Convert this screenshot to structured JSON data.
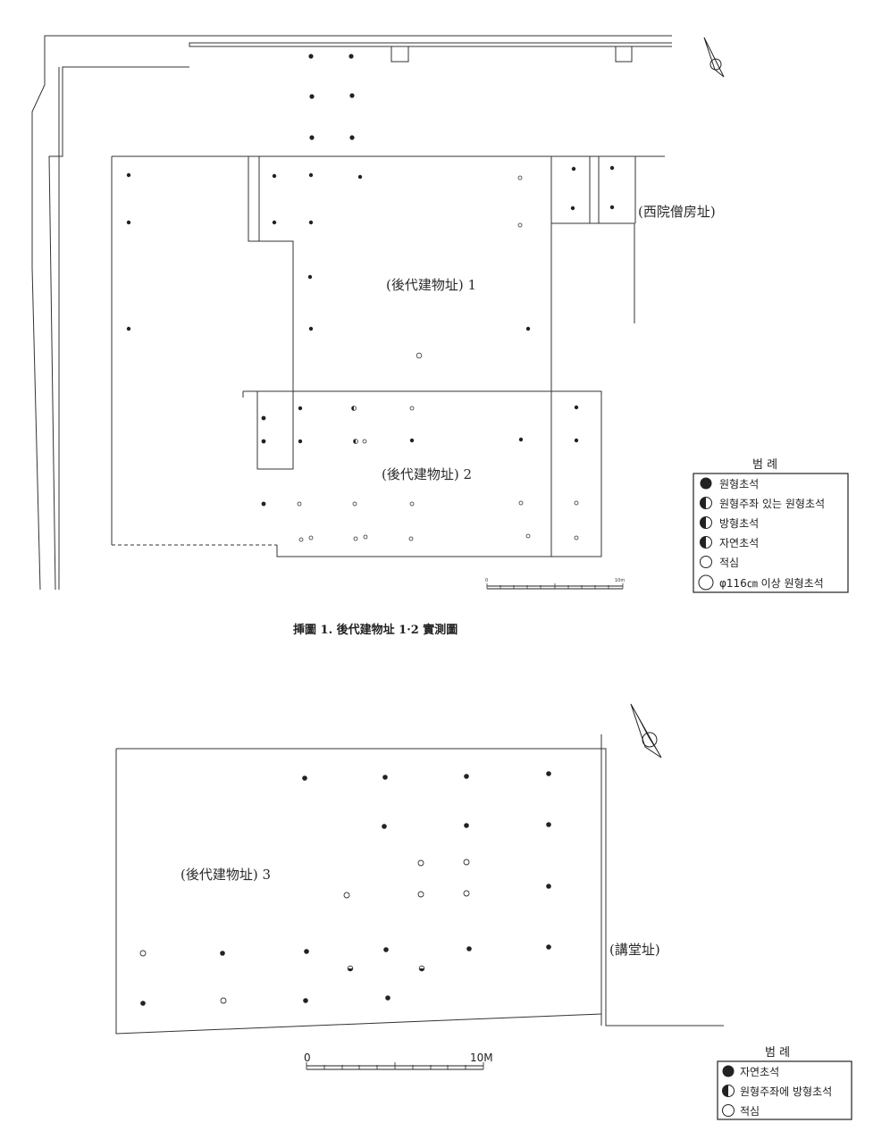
{
  "top_plan": {
    "labels": {
      "west_monk_quarters": "(西院僧房址)",
      "building1": "(後代建物址) 1",
      "building2": "(後代建物址) 2"
    },
    "scale": {
      "zero": "0",
      "end": "10m"
    },
    "caption": "挿圖 1. 後代建物址 1·2 實測圖",
    "legend": {
      "title": "범 례",
      "items": [
        {
          "symbol": "filled",
          "label": "원형초석"
        },
        {
          "symbol": "half",
          "label": "원형주좌 있는 원형초석"
        },
        {
          "symbol": "half",
          "label": "방형초석"
        },
        {
          "symbol": "half",
          "label": "자연초석"
        },
        {
          "symbol": "open",
          "label": "적심"
        },
        {
          "symbol": "open-large",
          "label": "φ116㎝ 이상 원형초석"
        }
      ]
    }
  },
  "bottom_plan": {
    "labels": {
      "building3": "(後代建物址) 3",
      "lecture_hall": "(講堂址)"
    },
    "scale": {
      "zero": "0",
      "end": "10M"
    },
    "legend": {
      "title": "범 례",
      "items": [
        {
          "symbol": "filled",
          "label": "자연초석"
        },
        {
          "symbol": "half",
          "label": "원형주좌에 방형초석"
        },
        {
          "symbol": "open",
          "label": "적심"
        }
      ]
    }
  },
  "icons": [
    "north-arrow-icon",
    "north-arrow-icon"
  ]
}
